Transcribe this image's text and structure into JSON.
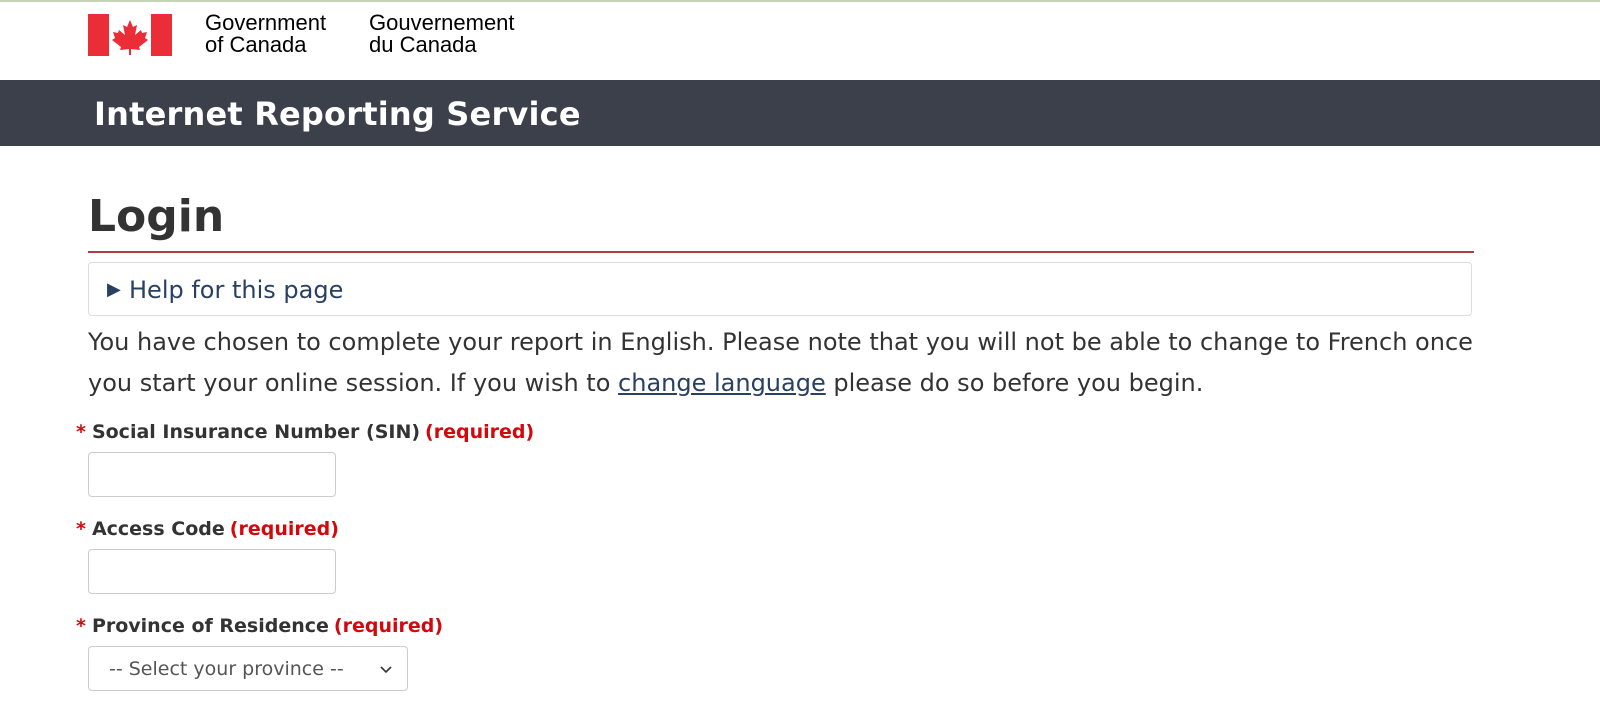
{
  "gov_header": {
    "name_en_line1": "Government",
    "name_en_line2": "of Canada",
    "name_fr_line1": "Gouvernement",
    "name_fr_line2": "du Canada",
    "flag_color": "#eb2d37"
  },
  "service_bar": {
    "title": "Internet Reporting Service",
    "background": "#3b404b"
  },
  "page": {
    "title": "Login",
    "title_rule_color": "#af3c43"
  },
  "help": {
    "label": "Help for this page",
    "icon": "caret-right-icon"
  },
  "intro": {
    "text_before_link": "You have chosen to complete your report in English. Please note that you will not be able to change to French once you start your online session. If you wish to ",
    "link_text": "change language",
    "text_after_link": " please do so before you begin."
  },
  "form": {
    "required_marker": "*",
    "required_text": "(required)",
    "sin": {
      "label": "Social Insurance Number (SIN)",
      "value": ""
    },
    "access_code": {
      "label": "Access Code",
      "value": ""
    },
    "province": {
      "label": "Province of Residence",
      "selected": "-- Select your province --",
      "icon": "chevron-down-icon"
    }
  }
}
